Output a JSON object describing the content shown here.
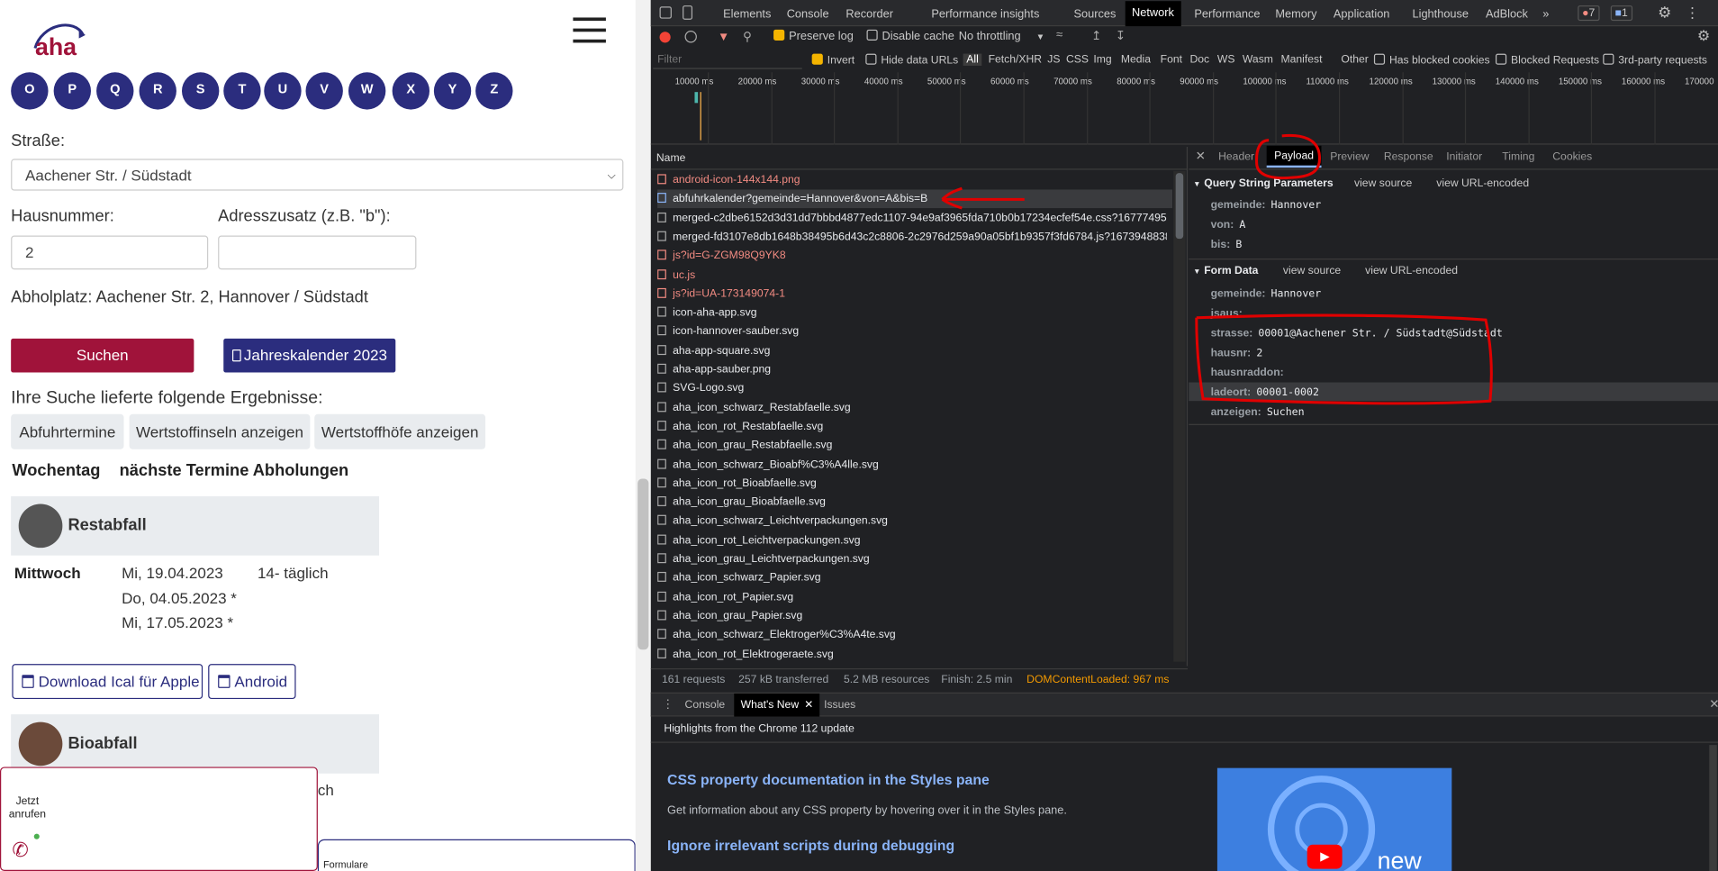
{
  "page": {
    "logo_text": "aha",
    "letters": [
      "O",
      "P",
      "Q",
      "R",
      "S",
      "T",
      "U",
      "V",
      "W",
      "X",
      "Y",
      "Z"
    ],
    "strasse_label": "Straße:",
    "strasse_value": "Aachener Str. / Südstadt",
    "hausnummer_label": "Hausnummer:",
    "adresszusatz_label": "Adresszusatz (z.B. \"b\"):",
    "hausnummer_value": "2",
    "abholplatz": "Abholplatz: Aachener Str. 2, Hannover / Südstadt",
    "search_button": "Suchen",
    "jahreskalender_button": "Jahreskalender 2023",
    "results_text": "Ihre Suche lieferte folgende Ergebnisse:",
    "result_tabs": [
      "Abfuhrtermine",
      "Wertstoffinseln anzeigen",
      "Wertstoffhöfe anzeigen"
    ],
    "col_wochentag": "Wochentag",
    "col_termine": "nächste Termine Abholungen",
    "restabfall": {
      "title": "Restabfall",
      "weekday": "Mittwoch",
      "dates": [
        "Mi, 19.04.2023",
        "Do, 04.05.2023 *",
        "Mi, 17.05.2023 *"
      ],
      "interval": "14- täglich"
    },
    "download_ical_apple": "Download Ical für Apple",
    "android_button": "Android",
    "bioabfall": {
      "title": "Bioabfall",
      "clipped_text": "ch"
    },
    "jetzt_anrufen": "Jetzt anrufen",
    "formulare": "Formulare"
  },
  "devtools": {
    "tabs": [
      "Elements",
      "Console",
      "Recorder",
      "Performance insights",
      "Sources",
      "Network",
      "Performance",
      "Memory",
      "Application",
      "Lighthouse",
      "AdBlock"
    ],
    "active_tab": "Network",
    "error_count": "7",
    "message_count": "1",
    "toolbar": {
      "preserve_log": "Preserve log",
      "disable_cache": "Disable cache",
      "throttling": "No throttling"
    },
    "filter_placeholder": "Filter",
    "filter_options": [
      "Invert",
      "Hide data URLs",
      "All",
      "Fetch/XHR",
      "JS",
      "CSS",
      "Img",
      "Media",
      "Font",
      "Doc",
      "WS",
      "Wasm",
      "Manifest",
      "Other",
      "Has blocked cookies",
      "Blocked Requests",
      "3rd-party requests"
    ],
    "timeline_ticks": [
      "10000 ms",
      "20000 ms",
      "30000 ms",
      "40000 ms",
      "50000 ms",
      "60000 ms",
      "70000 ms",
      "80000 ms",
      "90000 ms",
      "100000 ms",
      "110000 ms",
      "120000 ms",
      "130000 ms",
      "140000 ms",
      "150000 ms",
      "160000 ms",
      "170000"
    ],
    "name_header": "Name",
    "requests": [
      {
        "name": "android-icon-144x144.png",
        "error": true
      },
      {
        "name": "abfuhrkalender?gemeinde=Hannover&von=A&bis=B",
        "error": false,
        "selected": true
      },
      {
        "name": "merged-c2dbe6152d3d31dd7bbbd4877edc1107-94e9af3965fda710b0b17234ecfef54e.css?1677749530",
        "error": false
      },
      {
        "name": "merged-fd3107e8db1648b38495b6d43c2c8806-2c2976d259a90a05bf1b9357f3fd6784.js?1673948838",
        "error": false
      },
      {
        "name": "js?id=G-ZGM98Q9YK8",
        "error": true
      },
      {
        "name": "uc.js",
        "error": true
      },
      {
        "name": "js?id=UA-173149074-1",
        "error": true
      },
      {
        "name": "icon-aha-app.svg",
        "error": false
      },
      {
        "name": "icon-hannover-sauber.svg",
        "error": false
      },
      {
        "name": "aha-app-square.svg",
        "error": false
      },
      {
        "name": "aha-app-sauber.png",
        "error": false
      },
      {
        "name": "SVG-Logo.svg",
        "error": false
      },
      {
        "name": "aha_icon_schwarz_Restabfaelle.svg",
        "error": false
      },
      {
        "name": "aha_icon_rot_Restabfaelle.svg",
        "error": false
      },
      {
        "name": "aha_icon_grau_Restabfaelle.svg",
        "error": false
      },
      {
        "name": "aha_icon_schwarz_Bioabf%C3%A4lle.svg",
        "error": false
      },
      {
        "name": "aha_icon_rot_Bioabfaelle.svg",
        "error": false
      },
      {
        "name": "aha_icon_grau_Bioabfaelle.svg",
        "error": false
      },
      {
        "name": "aha_icon_schwarz_Leichtverpackungen.svg",
        "error": false
      },
      {
        "name": "aha_icon_rot_Leichtverpackungen.svg",
        "error": false
      },
      {
        "name": "aha_icon_grau_Leichtverpackungen.svg",
        "error": false
      },
      {
        "name": "aha_icon_schwarz_Papier.svg",
        "error": false
      },
      {
        "name": "aha_icon_rot_Papier.svg",
        "error": false
      },
      {
        "name": "aha_icon_grau_Papier.svg",
        "error": false
      },
      {
        "name": "aha_icon_schwarz_Elektroger%C3%A4te.svg",
        "error": false
      },
      {
        "name": "aha_icon_rot_Elektrogeraete.svg",
        "error": false
      }
    ],
    "status_bar": {
      "requests": "161 requests",
      "transferred": "257 kB transferred",
      "resources": "5.2 MB resources",
      "finish": "Finish: 2.5 min",
      "dcl": "DOMContentLoaded: 967 ms"
    },
    "detail_tabs": [
      "Headers",
      "Payload",
      "Preview",
      "Response",
      "Initiator",
      "Timing",
      "Cookies"
    ],
    "detail_tab_header_visible": "Header",
    "active_detail_tab": "Payload",
    "query_section": "Query String Parameters",
    "view_source": "view source",
    "view_url_encoded": "view URL-encoded",
    "query_params": [
      {
        "key": "gemeinde:",
        "value": "Hannover"
      },
      {
        "key": "von:",
        "value": "A"
      },
      {
        "key": "bis:",
        "value": "B"
      }
    ],
    "form_section": "Form Data",
    "form_params": [
      {
        "key": "gemeinde:",
        "value": "Hannover"
      },
      {
        "key": "jsaus:",
        "value": ""
      },
      {
        "key": "strasse:",
        "value": "00001@Aachener Str. / Südstadt@Südstadt"
      },
      {
        "key": "hausnr:",
        "value": "2"
      },
      {
        "key": "hausnraddon:",
        "value": ""
      },
      {
        "key": "ladeort:",
        "value": "00001-0002"
      },
      {
        "key": "anzeigen:",
        "value": "Suchen"
      }
    ],
    "drawer_tabs": [
      "Console",
      "What's New",
      "Issues"
    ],
    "whats_new_header": "Highlights from the Chrome 112 update",
    "whats_new_items": [
      {
        "title": "CSS property documentation in the Styles pane",
        "desc": "Get information about any CSS property by hovering over it in the Styles pane."
      },
      {
        "title": "Ignore irrelevant scripts during debugging",
        "desc": ""
      }
    ],
    "video_label": "new"
  },
  "colors": {
    "brand_red": "#a0133a",
    "brand_navy": "#2b2d7e",
    "annotation_red": "#e00000",
    "link_blue": "#8ab4f8"
  }
}
